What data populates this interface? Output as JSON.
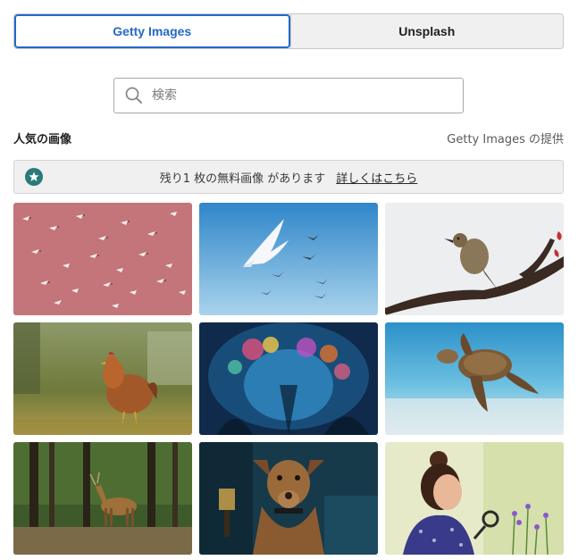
{
  "tabs": [
    {
      "label": "Getty Images",
      "active": true
    },
    {
      "label": "Unsplash",
      "active": false
    }
  ],
  "search": {
    "placeholder": "検索",
    "value": ""
  },
  "section": {
    "title": "人気の画像",
    "provider": "Getty Images の提供"
  },
  "notice": {
    "text": "残り1 枚の無料画像 があります",
    "link": "詳しくはこちら",
    "icon": "star-icon",
    "icon_color": "#2b7a7a"
  },
  "colors": {
    "accent": "#2468c9",
    "notice_bg": "#f0f0f0"
  },
  "images": [
    {
      "subject": "flamingos-flying-over-pink-water"
    },
    {
      "subject": "seagulls-in-blue-sky"
    },
    {
      "subject": "bird-perched-on-branch"
    },
    {
      "subject": "hen-in-grass"
    },
    {
      "subject": "coral-reef-underwater"
    },
    {
      "subject": "sea-turtle-swimming"
    },
    {
      "subject": "deer-in-forest"
    },
    {
      "subject": "brown-dog-sitting"
    },
    {
      "subject": "girl-with-magnifying-glass"
    }
  ]
}
